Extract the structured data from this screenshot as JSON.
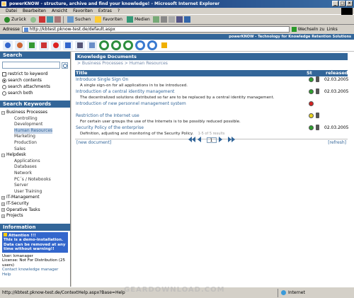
{
  "window": {
    "title": "powerKNOW - structure, archive and find your knowledge! - Microsoft Internet Explorer"
  },
  "menu": [
    "Datei",
    "Bearbeiten",
    "Ansicht",
    "Favoriten",
    "Extras",
    "?"
  ],
  "toolbar": {
    "back": "Zurück",
    "search": "Suchen",
    "favorites": "Favoriten",
    "media": "Medien"
  },
  "address": {
    "label": "Adresse",
    "url": "http://kbtest.pknow-test.de/default.aspx",
    "go": "Wechseln zu",
    "links": "Links"
  },
  "banner": {
    "brand": "powerKNOW - Technology for Knowledge Retention Solutions"
  },
  "sidebar": {
    "search_header": "Search",
    "search_value": "",
    "options": [
      {
        "label": "restrict to keyword",
        "type": "checkbox",
        "checked": false
      },
      {
        "label": "search contents",
        "type": "radio",
        "checked": true
      },
      {
        "label": "search attachments",
        "type": "radio",
        "checked": false
      },
      {
        "label": "search both",
        "type": "radio",
        "checked": false
      }
    ],
    "keywords_header": "Search Keywords",
    "tree": [
      {
        "label": "Business Processes",
        "level": 0,
        "expanded": true
      },
      {
        "label": "Controlling",
        "level": 1
      },
      {
        "label": "Development",
        "level": 1
      },
      {
        "label": "Human Resources",
        "level": 1,
        "selected": true
      },
      {
        "label": "Marketing",
        "level": 1
      },
      {
        "label": "Production",
        "level": 1
      },
      {
        "label": "Sales",
        "level": 1
      },
      {
        "label": "Helpdesk",
        "level": 0,
        "expanded": true
      },
      {
        "label": "Applications",
        "level": 1
      },
      {
        "label": "Databases",
        "level": 1
      },
      {
        "label": "Network",
        "level": 1
      },
      {
        "label": "PC´s / Notebooks",
        "level": 1
      },
      {
        "label": "Server",
        "level": 1
      },
      {
        "label": "User Training",
        "level": 1
      },
      {
        "label": "IT-Management",
        "level": 0,
        "expanded": false
      },
      {
        "label": "IT-Security",
        "level": 0,
        "expanded": false
      },
      {
        "label": "Operative Tasks",
        "level": 0,
        "expanded": false
      },
      {
        "label": "Projects",
        "level": 0,
        "expanded": false
      }
    ],
    "info_header": "Information",
    "info": {
      "attention": "Attention !!!",
      "attention_text": "This is a demo-installation. Data can be removed at any time without warning!!",
      "user": "User: kmanager",
      "license": "License: Not For Distribution (25 users)",
      "contact": "Contact knowledge manager",
      "help": "Help"
    }
  },
  "main": {
    "header": "Knowledge Documents",
    "breadcrumb": "> Business Processes > Human Resources",
    "columns": {
      "title": "Title",
      "status": "St",
      "released": "released"
    },
    "rows": [
      {
        "title": "Introduce Single Sign On",
        "desc": "A single sign-on for all applications in to be introduced.",
        "status_color": "#2e9e2e",
        "date": "02.03.2005"
      },
      {
        "title": "Introduction of a central identity management",
        "desc": "The decentralized solutions distributed so far are to be replaced by a central identity management.",
        "status_color": "#2e9e2e",
        "date": "02.03.2005"
      },
      {
        "title": "Introduction of new personnel management system",
        "desc": "",
        "status_color": "#d42020",
        "date": ""
      },
      {
        "title": "Restriction of the Internet use",
        "desc": "For certain user groups the use of the Internets is to be possibly reduced possible.",
        "status_color": "#e8d21a",
        "date": ""
      },
      {
        "title": "Security Policy of the enterprise",
        "desc": "Definition, adjusting and monitoring of the Security Policy.",
        "status_color": "#2e9e2e",
        "date": "02.03.2005"
      }
    ],
    "new_document": "[new document]",
    "refresh": "[refresh]",
    "paging_info": "1-5 of 5 results",
    "page": "1"
  },
  "status": {
    "url": "http://kbtest.pknow-test.de/ContextHelp.aspx?Base=Help",
    "zone": "Internet"
  },
  "watermark": "GEARDOWNLOAD.COM"
}
